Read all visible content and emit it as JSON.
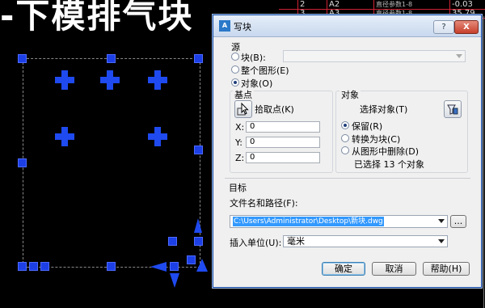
{
  "background": {
    "heading": "-下模排气块",
    "table_rows": [
      {
        "c1": "2",
        "c2": "A2",
        "c3": "直径参数1-8",
        "c4": "-0.03"
      },
      {
        "c1": "3",
        "c2": "A3",
        "c3": "直径参数1-8",
        "c4": "35.79"
      }
    ]
  },
  "dialog": {
    "title": "写块",
    "icon": "autocad-app-icon",
    "help_label": "?",
    "close_label": "X",
    "source": {
      "label": "源",
      "options": [
        {
          "label": "块(B):",
          "selected": false
        },
        {
          "label": "整个图形(E)",
          "selected": false
        },
        {
          "label": "对象(O)",
          "selected": true
        }
      ],
      "block_value": ""
    },
    "base_point": {
      "label": "基点",
      "pick_label": "拾取点(K)",
      "x_label": "X:",
      "x_value": "0",
      "y_label": "Y:",
      "y_value": "0",
      "z_label": "Z:",
      "z_value": "0"
    },
    "objects": {
      "label": "对象",
      "select_label": "选择对象(T)",
      "options": [
        {
          "label": "保留(R)",
          "selected": true
        },
        {
          "label": "转换为块(C)",
          "selected": false
        },
        {
          "label": "从图形中删除(D)",
          "selected": false
        }
      ],
      "status": "已选择 13 个对象"
    },
    "destination": {
      "label": "目标",
      "filename_label": "文件名和路径(F):",
      "filename_value": "C:\\Users\\Administrator\\Desktop\\新块.dwg",
      "browse_label": "...",
      "units_label": "插入单位(U):",
      "units_value": "毫米"
    },
    "buttons": {
      "ok": "确定",
      "cancel": "取消",
      "help": "帮助(H)"
    }
  },
  "colors": {
    "grip": "#1c3fe6",
    "selection_highlight": "#3399ff",
    "cad_background": "#000000"
  }
}
